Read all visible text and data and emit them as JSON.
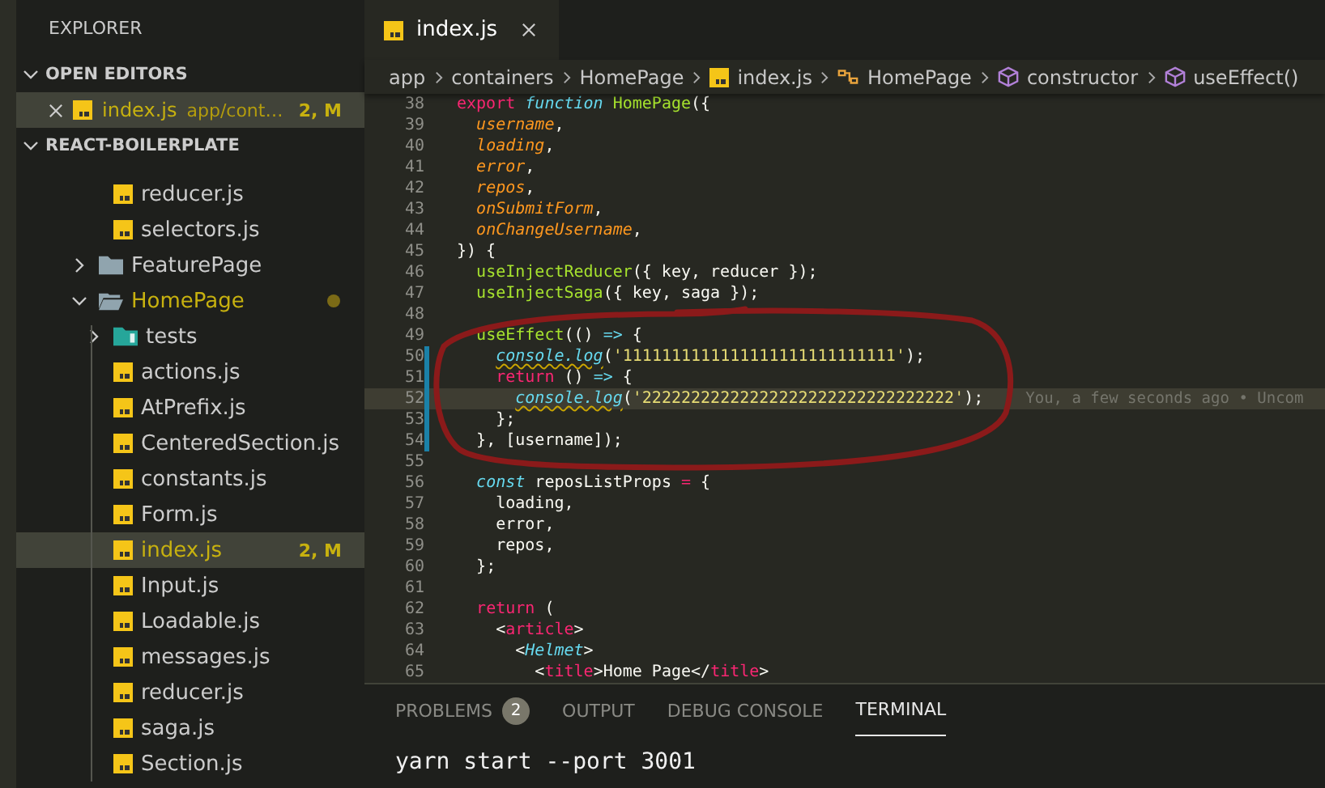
{
  "sidebar": {
    "title": "EXPLORER",
    "open_editors": {
      "title": "OPEN EDITORS",
      "expanded": true,
      "items": [
        {
          "name": "index.js",
          "path": "app/cont…",
          "badge": "2, M",
          "modified": true,
          "selected": true
        }
      ]
    },
    "project": {
      "title": "REACT-BOILERPLATE",
      "expanded": true,
      "tree": [
        {
          "kind": "continued",
          "children": [
            {
              "kind": "file",
              "name": "reducer.js",
              "selected": false,
              "modified": false
            },
            {
              "kind": "file",
              "name": "selectors.js",
              "selected": false,
              "modified": false
            }
          ]
        },
        {
          "kind": "folder",
          "name": "FeaturePage",
          "expanded": false,
          "modified": false
        },
        {
          "kind": "folder",
          "name": "HomePage",
          "expanded": true,
          "modified": true,
          "children": [
            {
              "kind": "test-folder",
              "name": "tests",
              "expanded": false,
              "modified": false
            },
            {
              "kind": "file",
              "name": "actions.js",
              "selected": false,
              "modified": false
            },
            {
              "kind": "file",
              "name": "AtPrefix.js",
              "selected": false,
              "modified": false
            },
            {
              "kind": "file",
              "name": "CenteredSection.js",
              "selected": false,
              "modified": false
            },
            {
              "kind": "file",
              "name": "constants.js",
              "selected": false,
              "modified": false
            },
            {
              "kind": "file",
              "name": "Form.js",
              "selected": false,
              "modified": false
            },
            {
              "kind": "file",
              "name": "index.js",
              "selected": true,
              "modified": true,
              "badge": "2, M"
            },
            {
              "kind": "file",
              "name": "Input.js",
              "selected": false,
              "modified": false
            },
            {
              "kind": "file",
              "name": "Loadable.js",
              "selected": false,
              "modified": false
            },
            {
              "kind": "file",
              "name": "messages.js",
              "selected": false,
              "modified": false
            },
            {
              "kind": "file",
              "name": "reducer.js",
              "selected": false,
              "modified": false
            },
            {
              "kind": "file",
              "name": "saga.js",
              "selected": false,
              "modified": false
            },
            {
              "kind": "file",
              "name": "Section.js",
              "selected": false,
              "modified": false
            }
          ]
        }
      ]
    }
  },
  "editor": {
    "tabs": [
      {
        "label": "index.js",
        "selected": true
      }
    ],
    "breadcrumbs": [
      {
        "kind": "text",
        "label": "app"
      },
      {
        "kind": "text",
        "label": "containers"
      },
      {
        "kind": "text",
        "label": "HomePage"
      },
      {
        "kind": "file",
        "label": "index.js"
      },
      {
        "kind": "module",
        "label": "HomePage"
      },
      {
        "kind": "method",
        "label": "constructor"
      },
      {
        "kind": "method",
        "label": "useEffect()"
      }
    ],
    "lines": [
      {
        "number": "38",
        "modified": false,
        "current": false,
        "tokens": [
          {
            "text": "export ",
            "kind": "keyword"
          },
          {
            "text": "function ",
            "kind": "storage"
          },
          {
            "text": "HomePage",
            "kind": "function"
          },
          {
            "text": "({",
            "kind": "plain"
          }
        ]
      },
      {
        "number": "39",
        "modified": false,
        "current": false,
        "tokens": [
          {
            "text": "  username",
            "kind": "param"
          },
          {
            "text": ",",
            "kind": "plain"
          }
        ]
      },
      {
        "number": "40",
        "modified": false,
        "current": false,
        "tokens": [
          {
            "text": "  loading",
            "kind": "param"
          },
          {
            "text": ",",
            "kind": "plain"
          }
        ]
      },
      {
        "number": "41",
        "modified": false,
        "current": false,
        "tokens": [
          {
            "text": "  error",
            "kind": "param"
          },
          {
            "text": ",",
            "kind": "plain"
          }
        ]
      },
      {
        "number": "42",
        "modified": false,
        "current": false,
        "tokens": [
          {
            "text": "  repos",
            "kind": "param"
          },
          {
            "text": ",",
            "kind": "plain"
          }
        ]
      },
      {
        "number": "43",
        "modified": false,
        "current": false,
        "tokens": [
          {
            "text": "  onSubmitForm",
            "kind": "param"
          },
          {
            "text": ",",
            "kind": "plain"
          }
        ]
      },
      {
        "number": "44",
        "modified": false,
        "current": false,
        "tokens": [
          {
            "text": "  onChangeUsername",
            "kind": "param"
          },
          {
            "text": ",",
            "kind": "plain"
          }
        ]
      },
      {
        "number": "45",
        "modified": false,
        "current": false,
        "tokens": [
          {
            "text": "}) {",
            "kind": "plain"
          }
        ]
      },
      {
        "number": "46",
        "modified": false,
        "current": false,
        "tokens": [
          {
            "text": "  useInjectReducer",
            "kind": "function"
          },
          {
            "text": "({ key, reducer });",
            "kind": "plain"
          }
        ]
      },
      {
        "number": "47",
        "modified": false,
        "current": false,
        "tokens": [
          {
            "text": "  useInjectSaga",
            "kind": "function"
          },
          {
            "text": "({ key, saga });",
            "kind": "plain"
          }
        ]
      },
      {
        "number": "48",
        "modified": false,
        "current": false
      },
      {
        "number": "49",
        "modified": false,
        "current": false,
        "tokens": [
          {
            "text": "  useEffect",
            "kind": "function"
          },
          {
            "text": "(() ",
            "kind": "plain"
          },
          {
            "text": "=>",
            "kind": "storage"
          },
          {
            "text": " {",
            "kind": "plain"
          }
        ]
      },
      {
        "number": "50",
        "modified": true,
        "current": false,
        "tokens": [
          {
            "text": "    console.log",
            "kind": "storage",
            "squiggle": true
          },
          {
            "text": "(",
            "kind": "plain"
          },
          {
            "text": "'1111111111111111111111111111'",
            "kind": "string"
          },
          {
            "text": ");",
            "kind": "plain"
          }
        ]
      },
      {
        "number": "51",
        "modified": true,
        "current": false,
        "tokens": [
          {
            "text": "    return ",
            "kind": "keyword"
          },
          {
            "text": "() ",
            "kind": "plain"
          },
          {
            "text": "=>",
            "kind": "storage"
          },
          {
            "text": " {",
            "kind": "plain"
          }
        ]
      },
      {
        "number": "52",
        "modified": true,
        "current": true,
        "blame": "You, a few seconds ago • Uncom",
        "tokens": [
          {
            "text": "      console.log",
            "kind": "storage",
            "squiggle": true
          },
          {
            "text": "(",
            "kind": "plain"
          },
          {
            "text": "'22222222222222222222222222222222'",
            "kind": "string"
          },
          {
            "text": ");",
            "kind": "plain"
          }
        ]
      },
      {
        "number": "53",
        "modified": true,
        "current": false,
        "tokens": [
          {
            "text": "    };",
            "kind": "plain"
          }
        ]
      },
      {
        "number": "54",
        "modified": true,
        "current": false,
        "tokens": [
          {
            "text": "  }, [username]);",
            "kind": "plain"
          }
        ]
      },
      {
        "number": "55",
        "modified": false,
        "current": false
      },
      {
        "number": "56",
        "modified": false,
        "current": false,
        "tokens": [
          {
            "text": "  const ",
            "kind": "storage"
          },
          {
            "text": "reposListProps ",
            "kind": "plain"
          },
          {
            "text": "=",
            "kind": "keyword"
          },
          {
            "text": " {",
            "kind": "plain"
          }
        ]
      },
      {
        "number": "57",
        "modified": false,
        "current": false,
        "tokens": [
          {
            "text": "    loading,",
            "kind": "plain"
          }
        ]
      },
      {
        "number": "58",
        "modified": false,
        "current": false,
        "tokens": [
          {
            "text": "    error,",
            "kind": "plain"
          }
        ]
      },
      {
        "number": "59",
        "modified": false,
        "current": false,
        "tokens": [
          {
            "text": "    repos,",
            "kind": "plain"
          }
        ]
      },
      {
        "number": "60",
        "modified": false,
        "current": false,
        "tokens": [
          {
            "text": "  };",
            "kind": "plain"
          }
        ]
      },
      {
        "number": "61",
        "modified": false,
        "current": false
      },
      {
        "number": "62",
        "modified": false,
        "current": false,
        "tokens": [
          {
            "text": "  return ",
            "kind": "keyword"
          },
          {
            "text": "(",
            "kind": "plain"
          }
        ]
      },
      {
        "number": "63",
        "modified": false,
        "current": false,
        "tokens": [
          {
            "text": "    <",
            "kind": "plain"
          },
          {
            "text": "article",
            "kind": "tag"
          },
          {
            "text": ">",
            "kind": "plain"
          }
        ]
      },
      {
        "number": "64",
        "modified": false,
        "current": false,
        "tokens": [
          {
            "text": "      <",
            "kind": "plain"
          },
          {
            "text": "Helmet",
            "kind": "storage"
          },
          {
            "text": ">",
            "kind": "plain"
          }
        ]
      },
      {
        "number": "65",
        "modified": false,
        "current": false,
        "tokens": [
          {
            "text": "        <",
            "kind": "plain"
          },
          {
            "text": "title",
            "kind": "tag"
          },
          {
            "text": ">Home Page</",
            "kind": "plain"
          },
          {
            "text": "title",
            "kind": "tag"
          },
          {
            "text": ">",
            "kind": "plain"
          }
        ]
      }
    ]
  },
  "panel": {
    "tabs": [
      {
        "label": "PROBLEMS",
        "badge": "2",
        "selected": false
      },
      {
        "label": "OUTPUT",
        "selected": false
      },
      {
        "label": "DEBUG CONSOLE",
        "selected": false
      },
      {
        "label": "TERMINAL",
        "selected": true
      }
    ],
    "terminal": [
      "yarn start --port 3001"
    ]
  }
}
